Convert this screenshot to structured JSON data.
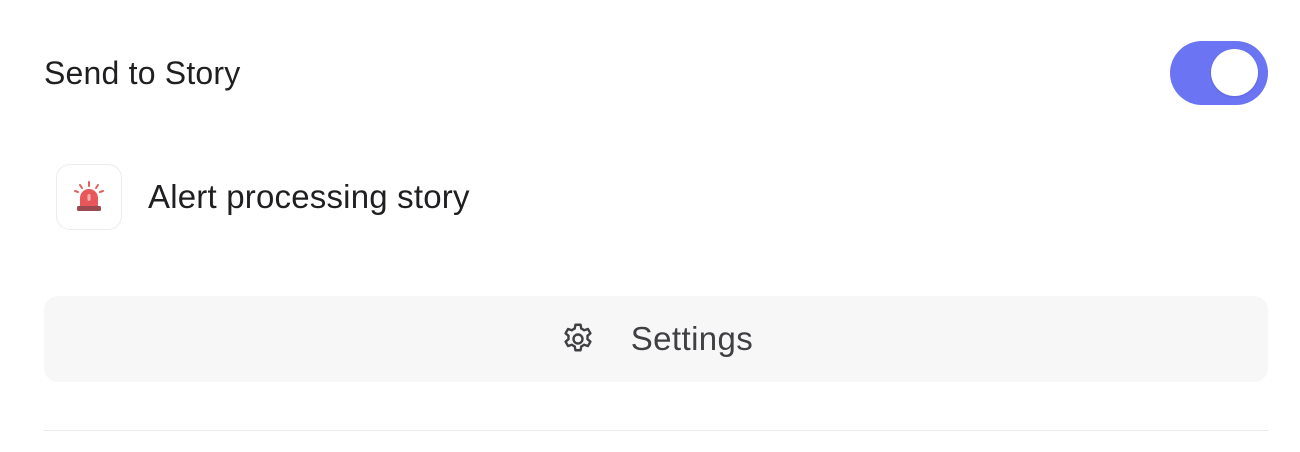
{
  "section": {
    "title": "Send to Story",
    "toggle_on": true,
    "toggle_color": "#6b74f2"
  },
  "story": {
    "icon": "siren-icon",
    "label": "Alert processing story"
  },
  "settings_button": {
    "icon": "gear-icon",
    "label": "Settings"
  }
}
